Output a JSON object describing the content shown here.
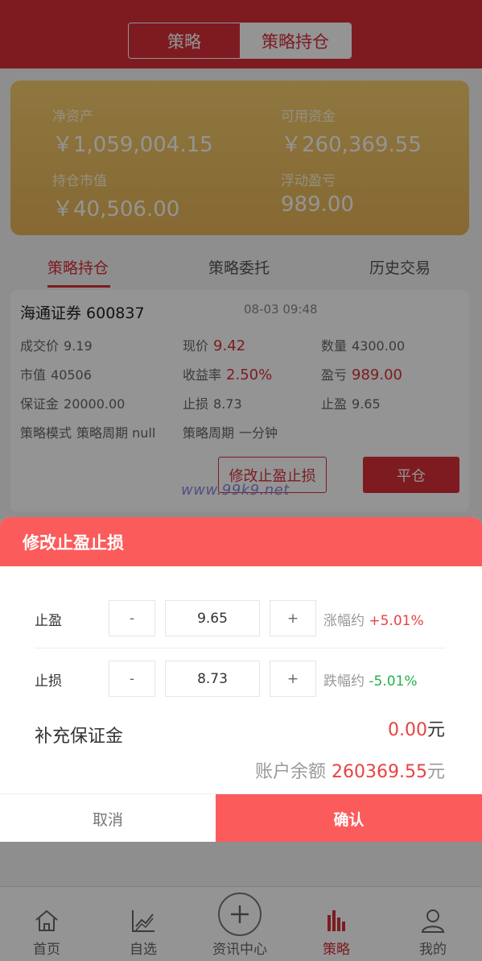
{
  "header": {
    "segments": [
      "策略",
      "策略持仓"
    ],
    "active_segment": "策略持仓"
  },
  "assets": {
    "net_assets_label": "净资产",
    "net_assets_value": "￥1,059,004.15",
    "available_label": "可用资金",
    "available_value": "￥260,369.55",
    "market_value_label": "持仓市值",
    "market_value_value": "￥40,506.00",
    "floating_pl_label": "浮动盈亏",
    "floating_pl_value": "989.00"
  },
  "tabs": {
    "positions": "策略持仓",
    "orders": "策略委托",
    "history": "历史交易"
  },
  "position": {
    "name": "海通证券 600837",
    "time": "08-03 09:48",
    "deal_price_label": "成交价",
    "deal_price": "9.19",
    "current_price_label": "现价",
    "current_price": "9.42",
    "quantity_label": "数量",
    "quantity": "4300.00",
    "market_value_label": "市值",
    "market_value": "40506",
    "return_label": "收益率",
    "return_rate": "2.50%",
    "pl_label": "盈亏",
    "pl": "989.00",
    "margin_label": "保证金",
    "margin": "20000.00",
    "stop_loss_label": "止损",
    "stop_loss": "8.73",
    "take_profit_label": "止盈",
    "take_profit": "9.65",
    "mode_label": "策略模式",
    "mode_value": "策略周期 null",
    "period_label": "策略周期",
    "period_value": "一分钟",
    "modify_button": "修改止盈止损",
    "close_button": "平仓"
  },
  "watermark": "www.99k9.net",
  "modal": {
    "title": "修改止盈止损",
    "take_profit_label": "止盈",
    "take_profit_value": "9.65",
    "take_profit_pct_label": "涨幅约",
    "take_profit_pct": "+5.01%",
    "stop_loss_label": "止损",
    "stop_loss_value": "8.73",
    "stop_loss_pct_label": "跌幅约",
    "stop_loss_pct": "-5.01%",
    "minus": "-",
    "plus": "+",
    "margin_label": "补充保证金",
    "margin_value": "0.00",
    "currency_unit": "元",
    "balance_label": "账户余额",
    "balance_value": "260369.55",
    "cancel": "取消",
    "confirm": "确认"
  },
  "tabbar": {
    "items": [
      {
        "label": "首页",
        "icon": "home-icon"
      },
      {
        "label": "自选",
        "icon": "chart-trend-icon"
      },
      {
        "label": "资讯中心",
        "icon": "plus-circle-icon"
      },
      {
        "label": "策略",
        "icon": "bar-chart-icon"
      },
      {
        "label": "我的",
        "icon": "user-icon"
      }
    ],
    "active": "策略"
  },
  "colors": {
    "brand_red": "#d8303a",
    "modal_red": "#fb5b5b",
    "gold_top": "#f6cd6e",
    "gold_bottom": "#e7b457",
    "up": "#e84343",
    "down": "#22b14c"
  }
}
